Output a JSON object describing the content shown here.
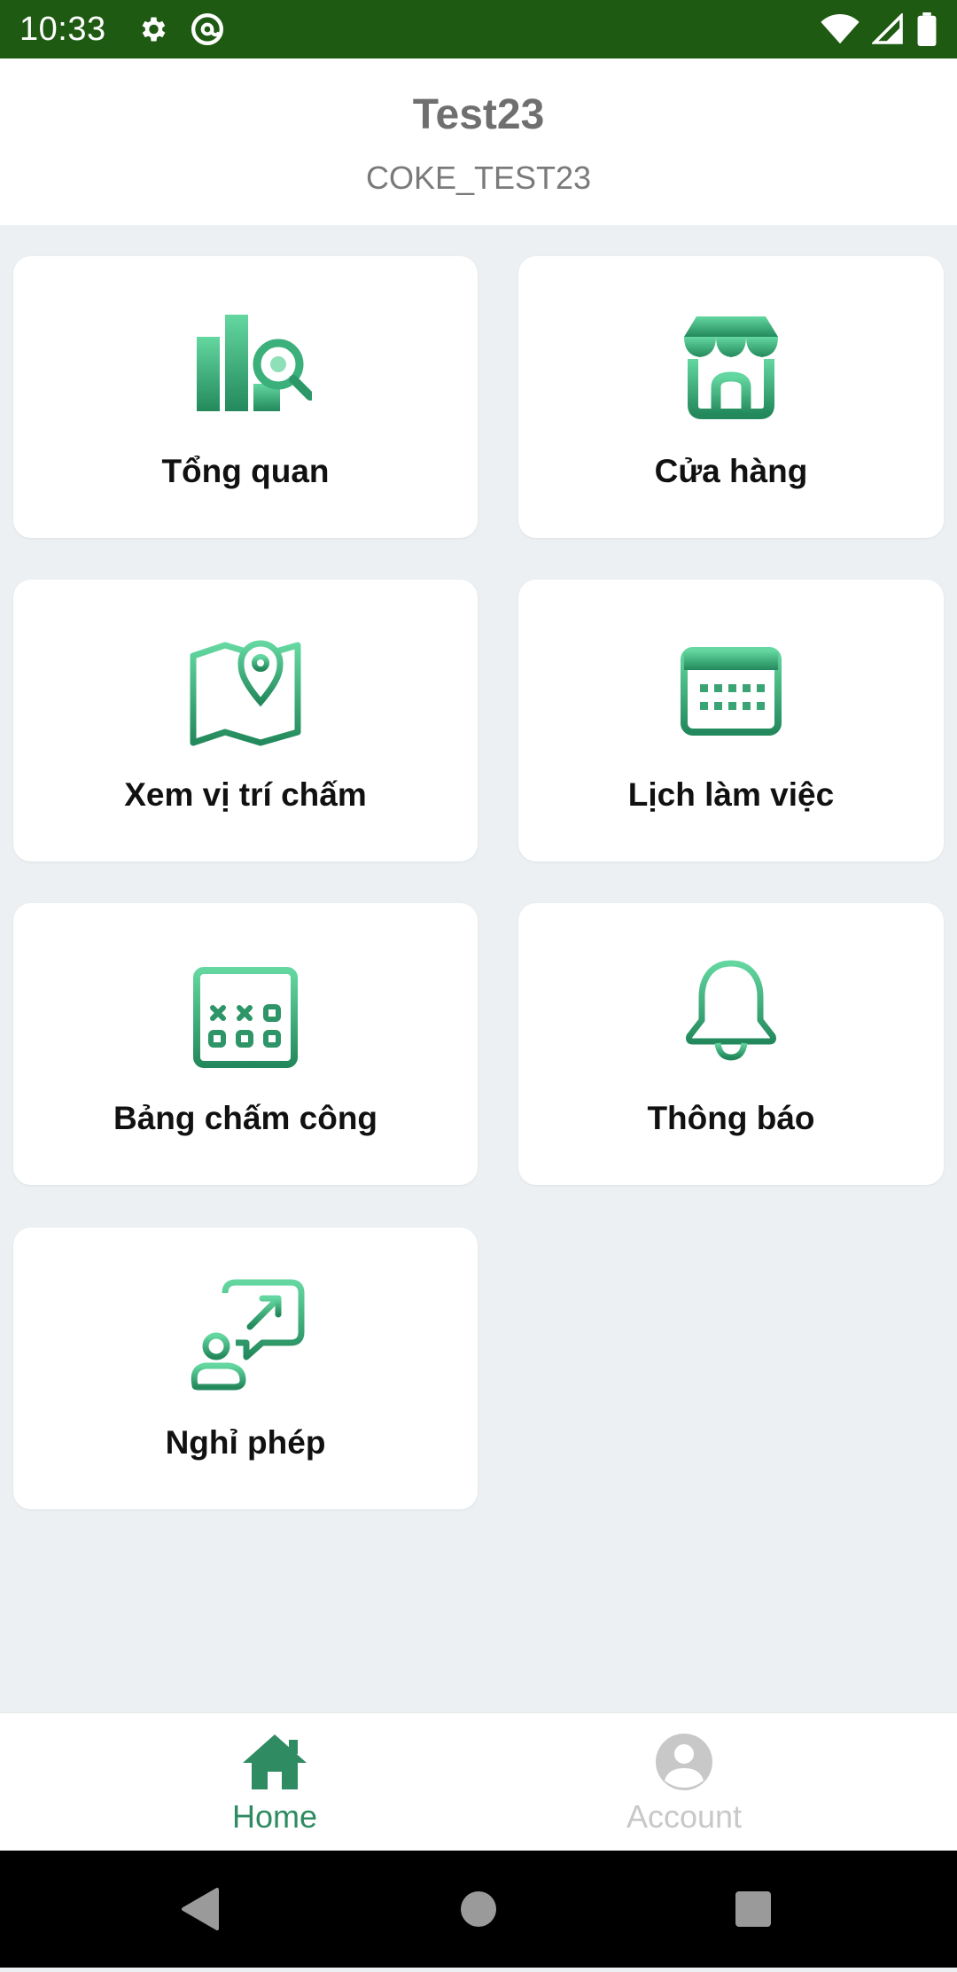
{
  "status_bar": {
    "time": "10:33",
    "icons": [
      "settings-icon",
      "at-sign-icon",
      "wifi-icon",
      "signal-icon",
      "battery-icon"
    ],
    "background": "#1e5a12"
  },
  "header": {
    "title": "Test23",
    "subtitle": "COKE_TEST23"
  },
  "menu": {
    "items": [
      {
        "label": "Tổng quan",
        "icon": "overview-chart-search-icon"
      },
      {
        "label": "Cửa hàng",
        "icon": "store-icon"
      },
      {
        "label": "Xem vị trí chấm",
        "icon": "map-location-icon"
      },
      {
        "label": "Lịch làm việc",
        "icon": "calendar-icon"
      },
      {
        "label": "Bảng chấm công",
        "icon": "timesheet-calendar-icon"
      },
      {
        "label": "Thông báo",
        "icon": "bell-icon"
      },
      {
        "label": "Nghỉ phép",
        "icon": "leave-request-icon"
      }
    ]
  },
  "bottom_nav": {
    "items": [
      {
        "label": "Home",
        "icon": "home-icon",
        "active": true
      },
      {
        "label": "Account",
        "icon": "account-icon",
        "active": false
      }
    ]
  },
  "colors": {
    "accent": "#2e8b62",
    "accent_light": "#5fd39a",
    "inactive": "#c8c8c8",
    "background": "#edf0f2"
  },
  "android_nav": [
    "back-icon",
    "home-circle-icon",
    "recents-icon"
  ]
}
